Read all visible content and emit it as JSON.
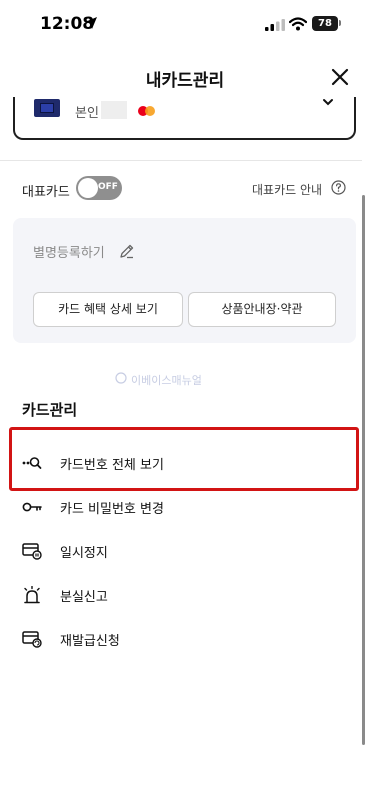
{
  "status_bar": {
    "time": "12:08",
    "battery": "78"
  },
  "header": {
    "title": "내카드관리"
  },
  "card_selector": {
    "owner": "본인"
  },
  "representative": {
    "label": "대표카드",
    "toggle_text": "OFF",
    "info_link": "대표카드 안내"
  },
  "nickname_panel": {
    "label": "별명등록하기",
    "buttons": [
      "카드 혜택 상세 보기",
      "상품안내장·약관"
    ]
  },
  "watermark": "이베이스매뉴얼",
  "card_management": {
    "title": "카드관리",
    "items": [
      {
        "label": "카드번호 전체 보기",
        "icon": "key-search-icon"
      },
      {
        "label": "카드 비밀번호 변경",
        "icon": "key-icon"
      },
      {
        "label": "일시정지",
        "icon": "card-pause-icon"
      },
      {
        "label": "분실신고",
        "icon": "siren-icon"
      },
      {
        "label": "재발급신청",
        "icon": "card-reissue-icon"
      }
    ]
  },
  "colors": {
    "highlight": "#d21414",
    "toggle_off": "#8f8f8f",
    "panel_bg": "#f4f5f9"
  }
}
